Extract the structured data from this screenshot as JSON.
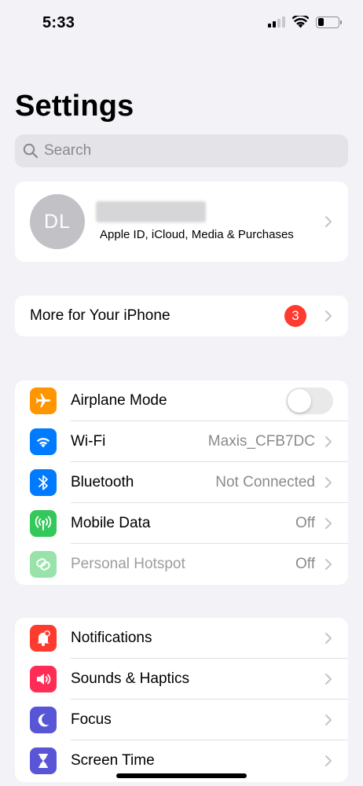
{
  "status_bar": {
    "time": "5:33",
    "battery_level": 0.3
  },
  "page": {
    "title": "Settings"
  },
  "search": {
    "placeholder": "Search",
    "value": ""
  },
  "profile": {
    "initials": "DL",
    "name": "",
    "subtitle": "Apple ID, iCloud, Media & Purchases"
  },
  "promo": {
    "label": "More for Your iPhone",
    "badge": "3"
  },
  "connectivity": {
    "items": [
      {
        "label": "Airplane Mode",
        "value": "",
        "control": "toggle",
        "on": false,
        "icon": "airplane-icon",
        "color": "#ff9500"
      },
      {
        "label": "Wi-Fi",
        "value": "Maxis_CFB7DC",
        "icon": "wifi-icon",
        "color": "#007aff"
      },
      {
        "label": "Bluetooth",
        "value": "Not Connected",
        "icon": "bluetooth-icon",
        "color": "#007aff"
      },
      {
        "label": "Mobile Data",
        "value": "Off",
        "icon": "antenna-icon",
        "color": "#34c759"
      },
      {
        "label": "Personal Hotspot",
        "value": "Off",
        "icon": "hotspot-icon",
        "color": "#34c759",
        "disabled": true
      }
    ]
  },
  "general": {
    "items": [
      {
        "label": "Notifications",
        "icon": "bell-icon",
        "color": "#ff3b30"
      },
      {
        "label": "Sounds & Haptics",
        "icon": "speaker-icon",
        "color": "#ff2d55"
      },
      {
        "label": "Focus",
        "icon": "moon-icon",
        "color": "#5856d6"
      },
      {
        "label": "Screen Time",
        "icon": "hourglass-icon",
        "color": "#5856d6"
      }
    ]
  }
}
